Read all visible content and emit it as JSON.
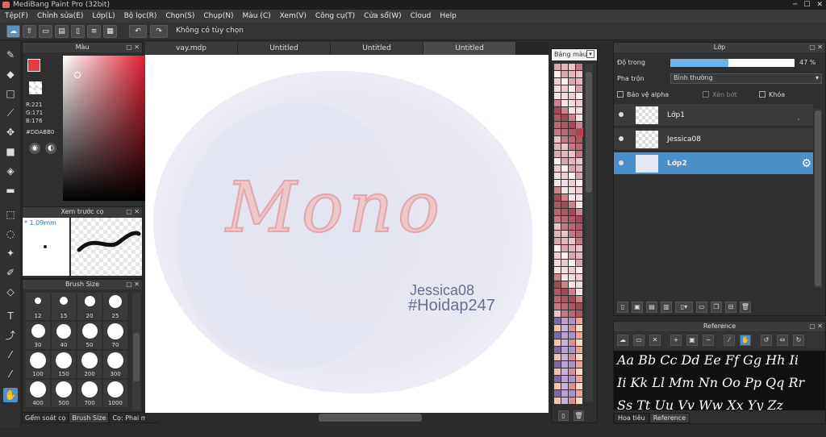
{
  "window": {
    "title": "MediBang Paint Pro (32bit)"
  },
  "menu": [
    "Tệp(F)",
    "Chỉnh sửa(E)",
    "Lớp(L)",
    "Bộ lọc(R)",
    "Chọn(S)",
    "Chụp(N)",
    "Màu (C)",
    "Xem(V)",
    "Công cụ(T)",
    "Cửa sổ(W)",
    "Cloud",
    "Help"
  ],
  "toolbar": {
    "selection_text": "Không có tùy chọn"
  },
  "color_panel": {
    "title": "Màu",
    "r": "R:221",
    "g": "G:171",
    "b": "B:176",
    "hex": "#DDABB0",
    "foreground": "#DDABB0"
  },
  "brush_preview": {
    "title": "Xem trước cọ",
    "size": "* 1.09mm"
  },
  "brush_size": {
    "title": "Brush Size",
    "sizes": [
      "12",
      "15",
      "20",
      "25",
      "30",
      "40",
      "50",
      "70",
      "100",
      "150",
      "200",
      "300",
      "400",
      "500",
      "700",
      "1000"
    ]
  },
  "left_tabs": [
    "Gểm soát cọ",
    "Brush Size",
    "Cọ: Phai màu"
  ],
  "doc_tabs": [
    "vay.mdp",
    "Untitled",
    "Untitled",
    "Untitled"
  ],
  "canvas": {
    "main_text": "Mono",
    "signature_line1": "Jessica08",
    "signature_line2": "#Hoidap247"
  },
  "palette": {
    "title": "Bảng màu"
  },
  "layers": {
    "title": "Lớp",
    "opacity_label": "Độ trong",
    "opacity_value": "47 %",
    "opacity": 0.47,
    "blend_label": "Pha trộn",
    "blend_value": "Bình thường",
    "protect_alpha": "Bảo vệ alpha",
    "clipping": "Xén bớt",
    "lock": "Khóa",
    "items": [
      {
        "name": "Lớp1",
        "selected": false
      },
      {
        "name": "Jessica08",
        "selected": false
      },
      {
        "name": "Lớp2",
        "selected": true
      }
    ]
  },
  "reference": {
    "title": "Reference",
    "lines": [
      "Aa Bb Cc Dd Ee Ff Gg Hh Ii",
      "Ii Kk Ll Mm Nn Oo Pp Qq Rr",
      "Ss Tt Uu Vv Ww Xx Yy Zz"
    ],
    "tabs": [
      "Hoa tiêu",
      "Reference"
    ]
  }
}
